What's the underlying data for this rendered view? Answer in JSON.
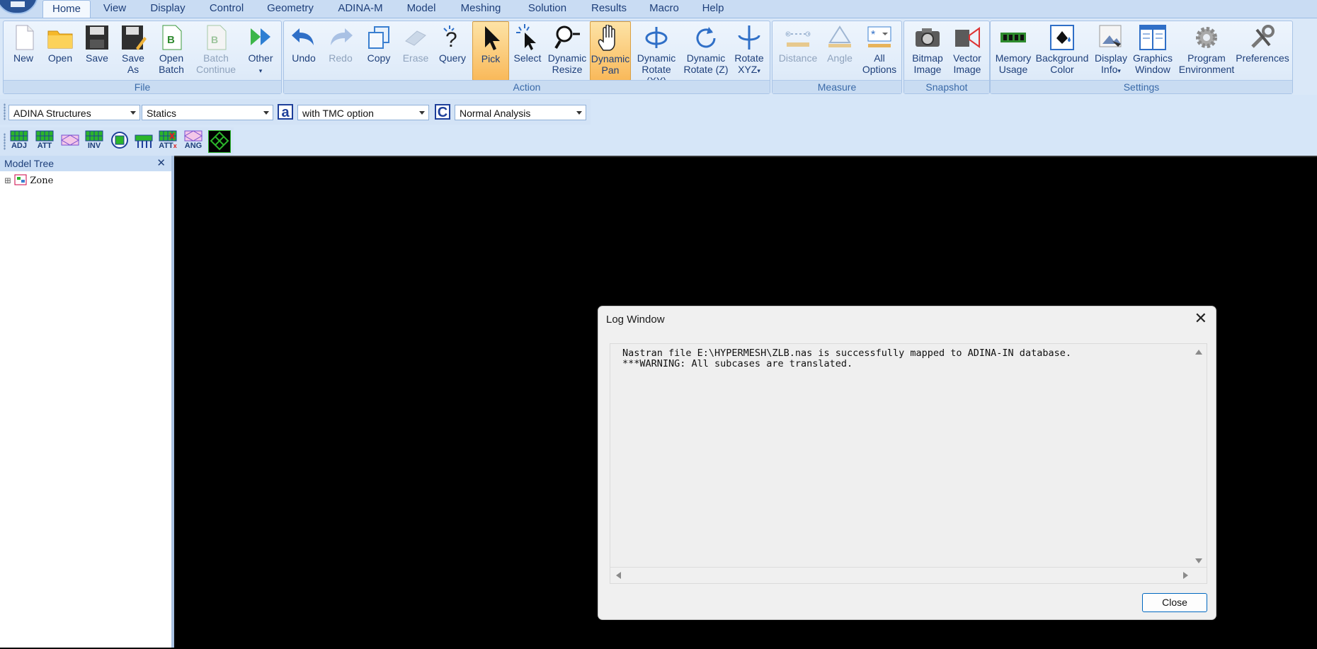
{
  "menu": {
    "tabs": [
      "Home",
      "View",
      "Display",
      "Control",
      "Geometry",
      "ADINA-M",
      "Model",
      "Meshing",
      "Solution",
      "Results",
      "Macro",
      "Help"
    ],
    "active": "Home"
  },
  "ribbon": {
    "groups": {
      "file": "File",
      "action": "Action",
      "measure": "Measure",
      "snapshot": "Snapshot",
      "settings": "Settings"
    },
    "file": {
      "new": "New",
      "open": "Open",
      "save": "Save",
      "save_as_1": "Save",
      "save_as_2": "As",
      "open_batch_1": "Open",
      "open_batch_2": "Batch",
      "batch_continue_1": "Batch",
      "batch_continue_2": "Continue",
      "other": "Other"
    },
    "action": {
      "undo": "Undo",
      "redo": "Redo",
      "copy": "Copy",
      "erase": "Erase",
      "query": "Query",
      "pick": "Pick",
      "select": "Select",
      "dyn_resize_1": "Dynamic",
      "dyn_resize_2": "Resize",
      "dyn_pan_1": "Dynamic",
      "dyn_pan_2": "Pan",
      "dyn_rot_xy_1": "Dynamic",
      "dyn_rot_xy_2": "Rotate (XY)",
      "dyn_rot_z_1": "Dynamic",
      "dyn_rot_z_2": "Rotate (Z)",
      "rotate_xyz_1": "Rotate",
      "rotate_xyz_2": "XYZ"
    },
    "measure": {
      "distance": "Distance",
      "angle": "Angle",
      "all_options_1": "All",
      "all_options_2": "Options"
    },
    "snapshot": {
      "bitmap_1": "Bitmap",
      "bitmap_2": "Image",
      "vector_1": "Vector",
      "vector_2": "Image"
    },
    "settings": {
      "memory_1": "Memory",
      "memory_2": "Usage",
      "bg_1": "Background",
      "bg_2": "Color",
      "display_info_1": "Display",
      "display_info_2": "Info",
      "graphics_1": "Graphics",
      "graphics_2": "Window",
      "program_1": "Program",
      "program_2": "Environment",
      "preferences": "Preferences"
    }
  },
  "program_bar": {
    "program": "ADINA Structures",
    "analysis_type": "Statics",
    "tmc_icon": "a",
    "tmc": "with TMC option",
    "analysis_icon": "C",
    "analysis": "Normal Analysis"
  },
  "mesh_toolbar": {
    "adj": "ADJ",
    "att": "ATT",
    "inv": "INV",
    "attx": "ATT",
    "angle": "ANG"
  },
  "model_tree": {
    "title": "Model Tree",
    "close": "✕",
    "expander": "⊞",
    "node": "Zone"
  },
  "log_window": {
    "title": "Log Window",
    "close_x": "✕",
    "line1": "Nastran file E:\\HYPERMESH\\ZLB.nas is successfully mapped to ADINA-IN database.",
    "line2": "***WARNING: All subcases are translated.",
    "close_button": "Close"
  },
  "colors": {
    "ribbon_bg": "#dae8f8",
    "pressed": "#f9b95a",
    "accent": "#0067c0",
    "graphics_bg": "#000000"
  }
}
